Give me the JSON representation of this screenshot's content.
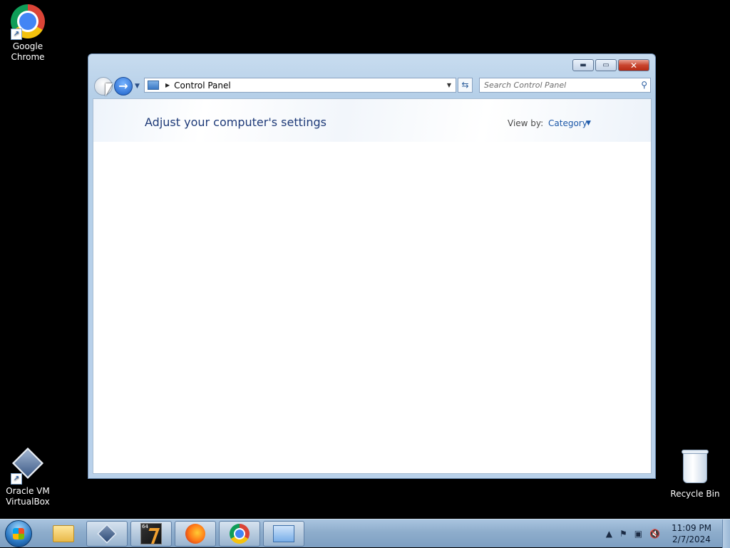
{
  "desktop": {
    "icons": [
      {
        "label_line1": "Google",
        "label_line2": "Chrome"
      },
      {
        "label_line1": "Oracle VM",
        "label_line2": "VirtualBox"
      },
      {
        "label_line1": "Recycle Bin",
        "label_line2": ""
      }
    ]
  },
  "window": {
    "breadcrumb": "Control Panel",
    "search_placeholder": "Search Control Panel",
    "page_title": "Adjust your computer's settings",
    "view_by_label": "View by:",
    "view_by_value": "Category",
    "buttons": {
      "minimize": "▬",
      "maximize": "▭",
      "close": "✕"
    }
  },
  "taskbar": {
    "pinned": [
      "Windows Explorer",
      "Oracle VM VirtualBox",
      "64-bit app",
      "Mozilla Firefox",
      "Google Chrome",
      "Control Panel"
    ],
    "app64_badge": "64",
    "clock_time": "11:09 PM",
    "clock_date": "2/7/2024"
  }
}
